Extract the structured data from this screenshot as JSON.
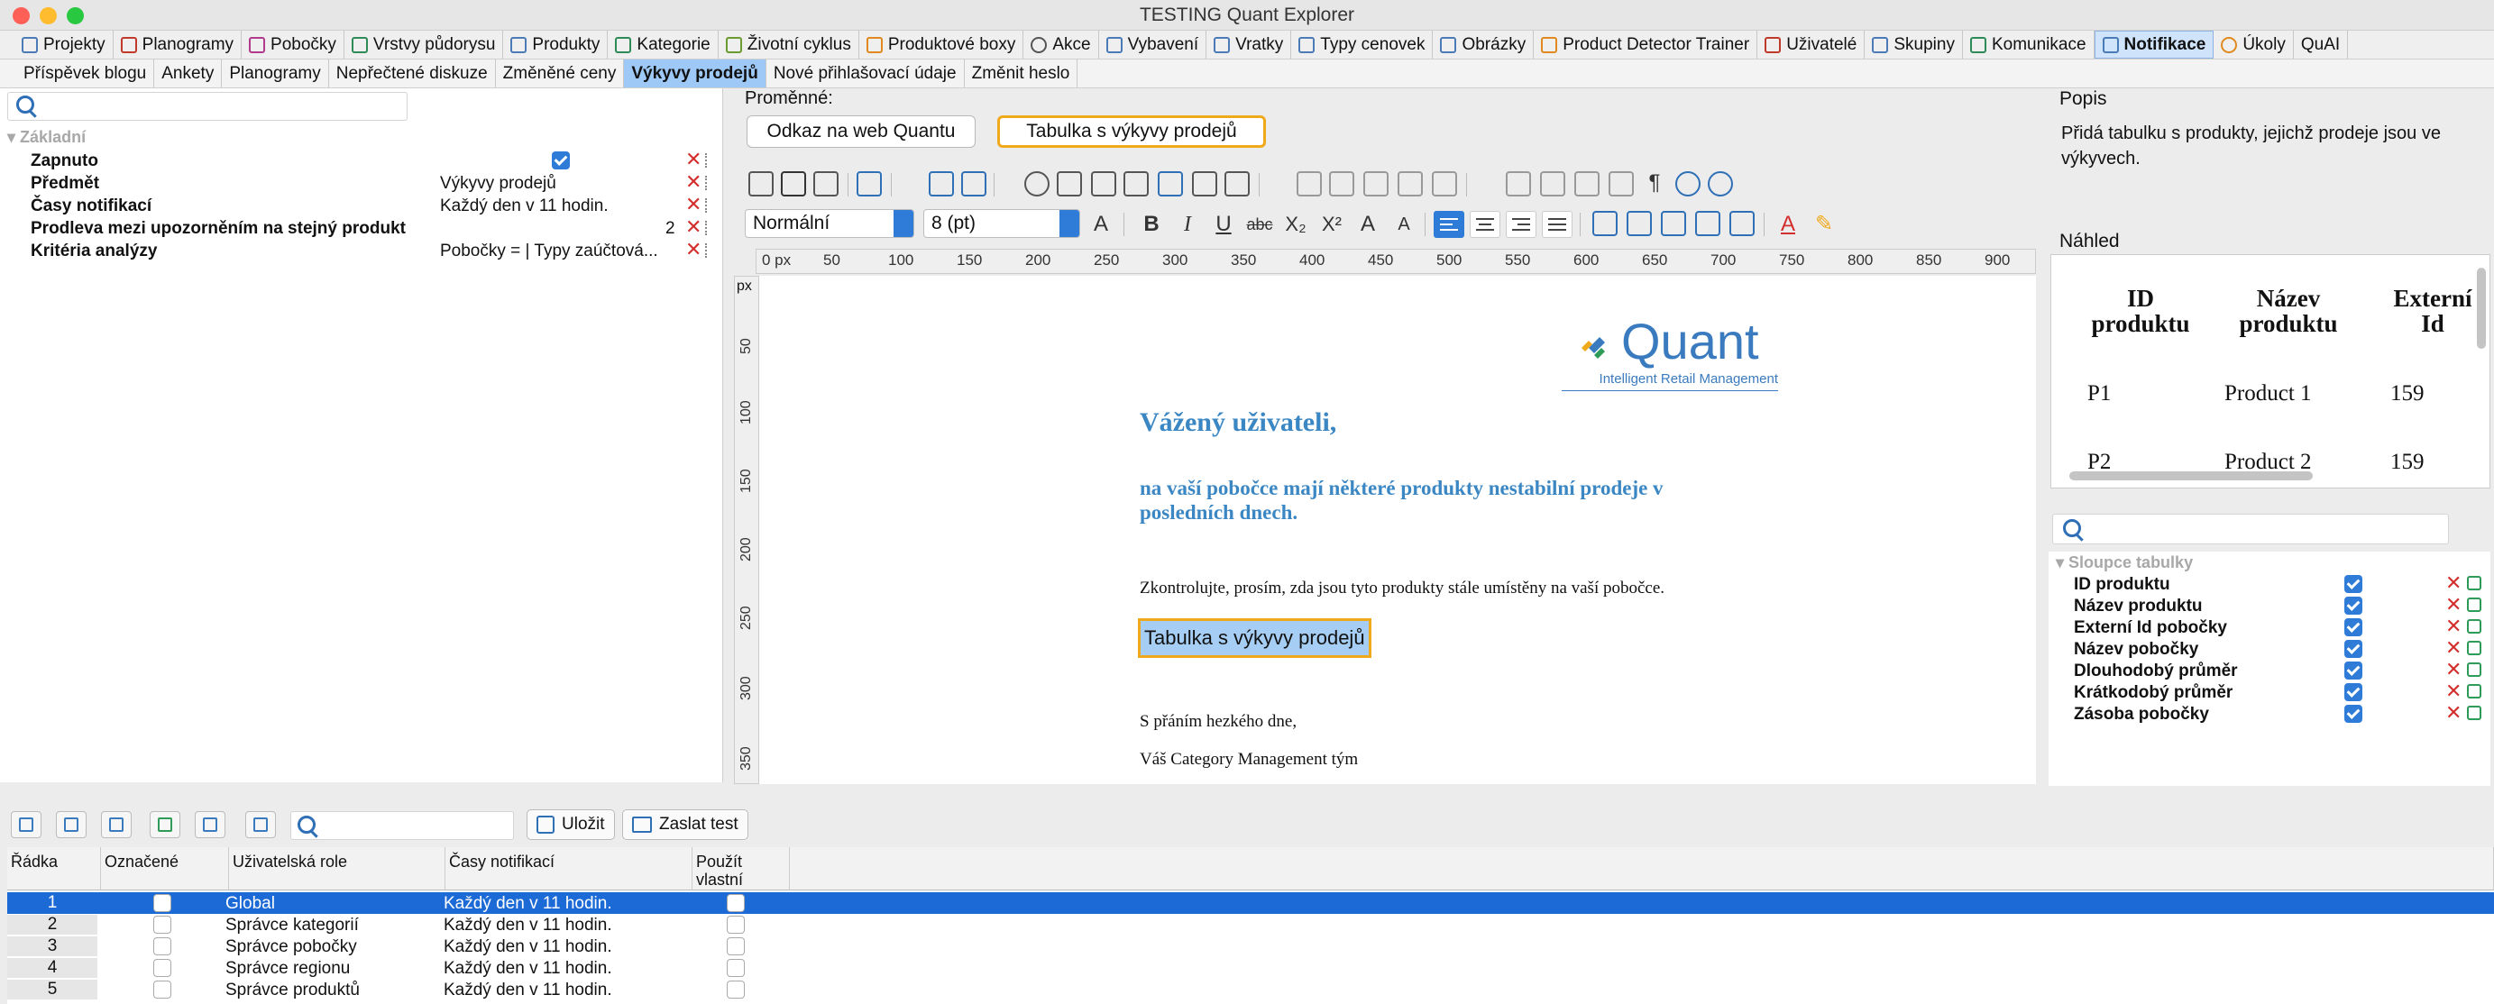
{
  "window": {
    "title": "TESTING Quant Explorer"
  },
  "top_tabs": [
    {
      "label": "Projekty",
      "active": false
    },
    {
      "label": "Planogramy",
      "active": false
    },
    {
      "label": "Pobočky",
      "active": false
    },
    {
      "label": "Vrstvy půdorysu",
      "active": false
    },
    {
      "label": "Produkty",
      "active": false
    },
    {
      "label": "Kategorie",
      "active": false
    },
    {
      "label": "Životní cyklus",
      "active": false
    },
    {
      "label": "Produktové boxy",
      "active": false
    },
    {
      "label": "Akce",
      "active": false
    },
    {
      "label": "Vybavení",
      "active": false
    },
    {
      "label": "Vratky",
      "active": false
    },
    {
      "label": "Typy cenovek",
      "active": false
    },
    {
      "label": "Obrázky",
      "active": false
    },
    {
      "label": "Product Detector Trainer",
      "active": false
    },
    {
      "label": "Uživatelé",
      "active": false
    },
    {
      "label": "Skupiny",
      "active": false
    },
    {
      "label": "Komunikace",
      "active": false
    },
    {
      "label": "Notifikace",
      "active": true
    },
    {
      "label": "Úkoly",
      "active": false
    },
    {
      "label": "QuAI",
      "active": false
    }
  ],
  "sub_tabs": [
    {
      "label": "Příspěvek blogu",
      "active": false
    },
    {
      "label": "Ankety",
      "active": false
    },
    {
      "label": "Planogramy",
      "active": false
    },
    {
      "label": "Nepřečtené diskuze",
      "active": false
    },
    {
      "label": "Změněné ceny",
      "active": false
    },
    {
      "label": "Výkyvy prodejů",
      "active": true
    },
    {
      "label": "Nové přihlašovací údaje",
      "active": false
    },
    {
      "label": "Změnit heslo",
      "active": false
    }
  ],
  "properties": {
    "search_value": "",
    "section": "Základní",
    "rows": [
      {
        "label": "Zapnuto",
        "value": "",
        "checked": true
      },
      {
        "label": "Předmět",
        "value": "Výkyvy prodejů"
      },
      {
        "label": "Časy notifikací",
        "value": "Každý den v 11 hodin."
      },
      {
        "label": "Prodleva mezi upozorněním na stejný produkt",
        "value": "",
        "number": "2"
      },
      {
        "label": "Kritéria analýzy",
        "value": "Pobočky =  | Typy zaúčtová..."
      }
    ]
  },
  "variables": {
    "label": "Proměnné:",
    "buttons": [
      {
        "label": "Odkaz na web Quantu",
        "selected": false
      },
      {
        "label": "Tabulka s výkyvy prodejů",
        "selected": true
      }
    ]
  },
  "editor": {
    "style_select": "Normální",
    "size_select": "8 (pt)",
    "ruler_unit": "px",
    "ruler_h": [
      "0 px",
      "50",
      "100",
      "150",
      "200",
      "250",
      "300",
      "350",
      "400",
      "450",
      "500",
      "550",
      "600",
      "650",
      "700",
      "750",
      "800",
      "850",
      "900"
    ],
    "ruler_v": [
      "px",
      "50",
      "100",
      "150",
      "200",
      "250",
      "300",
      "350"
    ]
  },
  "document": {
    "logo_text": "Quant",
    "logo_subtitle": "Intelligent Retail Management",
    "greeting": "Vážený uživateli,",
    "intro": "na vaší pobočce mají některé produkty nestabilní prodeje v posledních dnech.",
    "check": "Zkontrolujte, prosím, zda jsou tyto produkty stále umístěny na vaší pobočce.",
    "table_placeholder": "Tabulka s výkyvy prodejů",
    "regards": "S přáním hezkého dne,",
    "team": "Váš Category Management tým"
  },
  "description": {
    "header": "Popis",
    "text": "Přidá tabulku s produkty, jejichž prodeje jsou ve výkyvech."
  },
  "preview": {
    "header": "Náhled",
    "columns": [
      "ID produktu",
      "Název produktu",
      "Externí Id"
    ],
    "rows": [
      [
        "P1",
        "Product 1",
        "159"
      ],
      [
        "P2",
        "Product 2",
        "159"
      ]
    ]
  },
  "columns_panel": {
    "search_value": "",
    "section": "Sloupce tabulky",
    "items": [
      {
        "label": "ID produktu",
        "checked": true
      },
      {
        "label": "Název produktu",
        "checked": true
      },
      {
        "label": "Externí Id pobočky",
        "checked": true
      },
      {
        "label": "Název pobočky",
        "checked": true
      },
      {
        "label": "Dlouhodobý průměr",
        "checked": true
      },
      {
        "label": "Krátkodobý průměr",
        "checked": true
      },
      {
        "label": "Zásoba pobočky",
        "checked": true
      }
    ]
  },
  "bottom_toolbar": {
    "search_value": "",
    "save_label": "Uložit",
    "send_test_label": "Zaslat test"
  },
  "grid": {
    "headers": [
      "Řádka",
      "Označené",
      "Uživatelská role",
      "Časy notifikací",
      "Použít vlastní"
    ],
    "rows": [
      {
        "num": "1",
        "role": "Global",
        "times": "Každý den v 11 hodin.",
        "selected": true
      },
      {
        "num": "2",
        "role": "Správce kategorií",
        "times": "Každý den v 11 hodin.",
        "selected": false
      },
      {
        "num": "3",
        "role": "Správce pobočky",
        "times": "Každý den v 11 hodin.",
        "selected": false
      },
      {
        "num": "4",
        "role": "Správce regionu",
        "times": "Každý den v 11 hodin.",
        "selected": false
      },
      {
        "num": "5",
        "role": "Správce produktů",
        "times": "Každý den v 11 hodin.",
        "selected": false
      }
    ]
  },
  "colors": {
    "accent": "#2f7bd8",
    "selection": "#1c6ad6",
    "highlight": "#f0a91b",
    "heading": "#3b87c4",
    "delete": "#d32f2f"
  }
}
